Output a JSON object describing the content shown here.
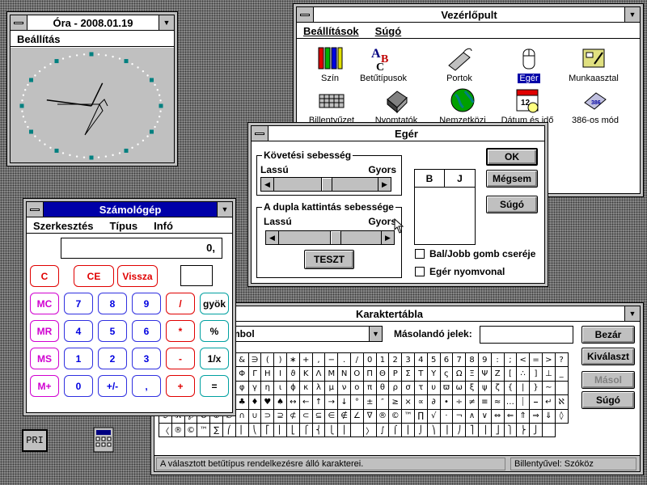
{
  "clock": {
    "title": "Óra - 2008.01.19",
    "menu": "Beállítás",
    "hour_hand_deg": 20,
    "minute_hand_deg": -80
  },
  "control_panel": {
    "title": "Vezérlőpult",
    "menus": [
      "Beállítások",
      "Súgó"
    ],
    "items": [
      {
        "label": "Szín",
        "icon": "color-icon"
      },
      {
        "label": "Betűtípusok",
        "icon": "fonts-icon"
      },
      {
        "label": "Portok",
        "icon": "ports-icon"
      },
      {
        "label": "Egér",
        "icon": "mouse-icon",
        "selected": true
      },
      {
        "label": "Munkaasztal",
        "icon": "desktop-icon"
      },
      {
        "label": "Billentyűzet",
        "icon": "keyboard-icon"
      },
      {
        "label": "Nyomtatók",
        "icon": "printer-icon"
      },
      {
        "label": "Nemzetközi",
        "icon": "globe-icon"
      },
      {
        "label": "Dátum és idő",
        "icon": "calendar-icon"
      },
      {
        "label": "386-os mód",
        "icon": "chip-icon"
      }
    ]
  },
  "mouse_dialog": {
    "title": "Egér",
    "tracking": {
      "label": "Követési sebesség",
      "slow": "Lassú",
      "fast": "Gyors",
      "value": 0.5
    },
    "doubleclick": {
      "label": "A dupla kattintás sebessége",
      "slow": "Lassú",
      "fast": "Gyors",
      "value": 0.55
    },
    "test_button": "TESZT",
    "ok": "OK",
    "cancel": "Mégsem",
    "help": "Súgó",
    "b_label": "B",
    "j_label": "J",
    "swap_label": "Bal/Jobb gomb cseréje",
    "trails_label": "Egér nyomvonal",
    "swap_checked": false,
    "trails_checked": false
  },
  "calculator": {
    "title": "Számológép",
    "menus": [
      "Szerkesztés",
      "Típus",
      "Infó"
    ],
    "display": "0,",
    "top_buttons": [
      "C",
      "CE",
      "Vissza"
    ],
    "memory_buttons": [
      "MC",
      "MR",
      "MS",
      "M+"
    ],
    "rows": [
      [
        "7",
        "8",
        "9",
        "/",
        "gyök"
      ],
      [
        "4",
        "5",
        "6",
        "*",
        "%"
      ],
      [
        "1",
        "2",
        "3",
        "-",
        "1/x"
      ],
      [
        "0",
        "+/-",
        ",",
        "+",
        "="
      ]
    ]
  },
  "charmap": {
    "title": "Karaktertábla",
    "font": "mbol",
    "copy_label": "Másolandó jelek:",
    "copy_value": "",
    "buttons": [
      "Bezár",
      "Kiválaszt",
      "Másol",
      "Súgó"
    ],
    "status_left": "A választott betűtípus rendelkezésre álló karakterei.",
    "status_right": "Billentyűvel: Szóköz",
    "grid": " !∀#∃%&∋()∗+,−./0123456789:;<=>?≅ΑΒΧΔΕΦΓΗΙϑΚΛΜΝΟΠΘΡΣΤΥςΩΞΨΖ[∴]⊥_ αβχδεφγηιϕκλμνοπθρστυϖωξψζ{|}∼ ϒ′≤⁄∞ƒ♣♦♥♠↔←↑→↓°±″≥×∝∂•÷≠≡≈…⏐⎯↵ℵℑℜ℘⊗⊕∅∩∪⊃⊇⊄⊂⊆∈∉∠∇®©™∏√⋅¬∧∨⇔⇐⇑⇒⇓◊〈®©™∑⎛⎜⎝⎡⎢⎣⎧⎨⎩⎪ 〉∫⌠⎮⌡⎞⎟⎠⎤⎥⎦⎫⎬⎭ "
  },
  "desktop_icons": [
    {
      "label": "PRI",
      "icon": "app-icon"
    },
    {
      "label": "",
      "icon": "calculator-icon"
    }
  ]
}
